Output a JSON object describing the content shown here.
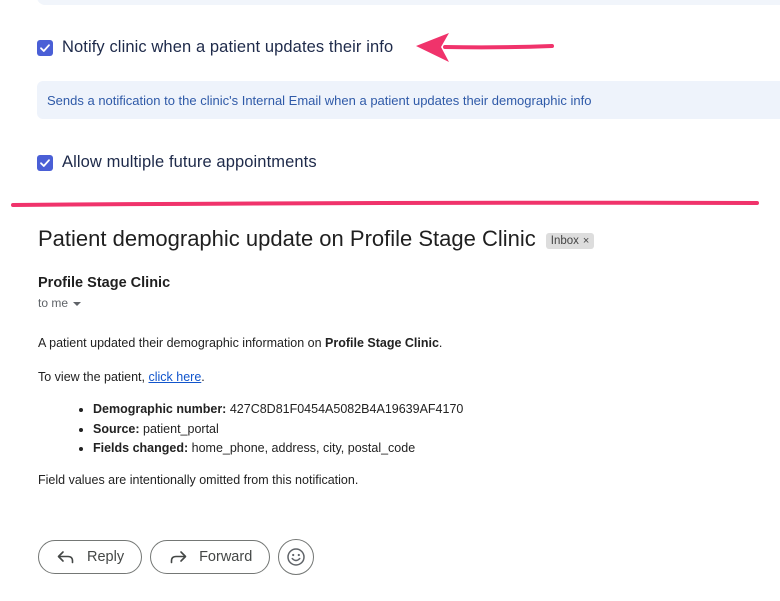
{
  "settings": {
    "notify_label": "Notify clinic when a patient updates their info",
    "notify_checked": true,
    "notify_description": "Sends a notification to the clinic's Internal Email when a patient updates their demographic info",
    "multi_label": "Allow multiple future appointments",
    "multi_checked": true
  },
  "annotation_color": "#f0336b",
  "email": {
    "subject": "Patient demographic update on Profile Stage Clinic",
    "label_chip": "Inbox",
    "chip_close": "×",
    "sender": "Profile Stage Clinic",
    "recipient": "to me",
    "intro_prefix": "A patient updated their demographic information on ",
    "intro_clinic": "Profile Stage Clinic",
    "intro_suffix": ".",
    "view_prefix": "To view the patient, ",
    "view_link": "click here",
    "view_suffix": ".",
    "fields": [
      {
        "label": "Demographic number:",
        "value": " 427C8D81F0454A5082B4A19639AF4170"
      },
      {
        "label": "Source:",
        "value": " patient_portal"
      },
      {
        "label": "Fields changed:",
        "value": " home_phone, address, city, postal_code"
      }
    ],
    "footer_note": "Field values are intentionally omitted from this notification."
  },
  "actions": {
    "reply_label": "Reply",
    "forward_label": "Forward"
  },
  "icons": [
    "checkbox-checked-icon",
    "reply-icon",
    "forward-icon",
    "emoji-icon"
  ]
}
